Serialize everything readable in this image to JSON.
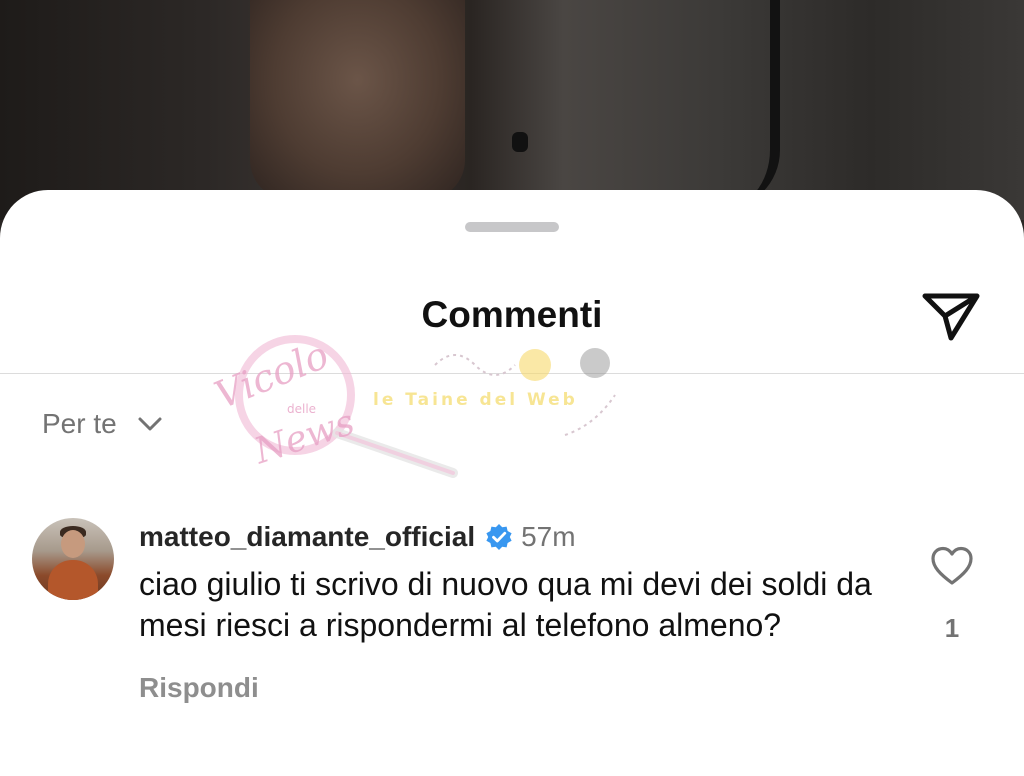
{
  "sheet": {
    "title": "Commenti",
    "share_icon": "paper-plane-icon"
  },
  "sort": {
    "label": "Per te",
    "icon": "chevron-down-icon"
  },
  "watermark": {
    "line1": "Vicolo",
    "line2": "delle",
    "line3": "News",
    "tagline": "le Taine del Web"
  },
  "comment": {
    "username": "matteo_diamante_official",
    "verified_icon": "verified-badge-icon",
    "timestamp": "57m",
    "text": "ciao giulio ti scrivo di nuovo qua mi devi dei soldi da mesi riesci a rispondermi al telefono almeno?",
    "reply_label": "Rispondi",
    "like_icon": "heart-icon",
    "like_count": "1"
  },
  "colors": {
    "verified": "#3897f0",
    "muted_text": "#737373",
    "watermark_pink": "#e79fc4",
    "watermark_yellow": "#f2d04a"
  }
}
